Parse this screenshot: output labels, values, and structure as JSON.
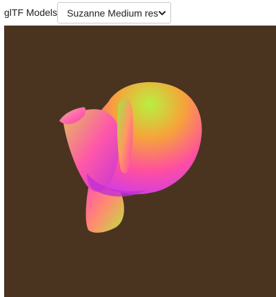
{
  "toolbar": {
    "label": "glTF Models:",
    "select": {
      "selected": "Suzanne Medium res",
      "icon": "chevron-down-icon"
    }
  },
  "viewport": {
    "background_color": "#4a3420",
    "model": "suzanne-mesh",
    "shading_colors": [
      "#b8f040",
      "#ff9a3a",
      "#ff3fa8",
      "#d03be8"
    ]
  }
}
